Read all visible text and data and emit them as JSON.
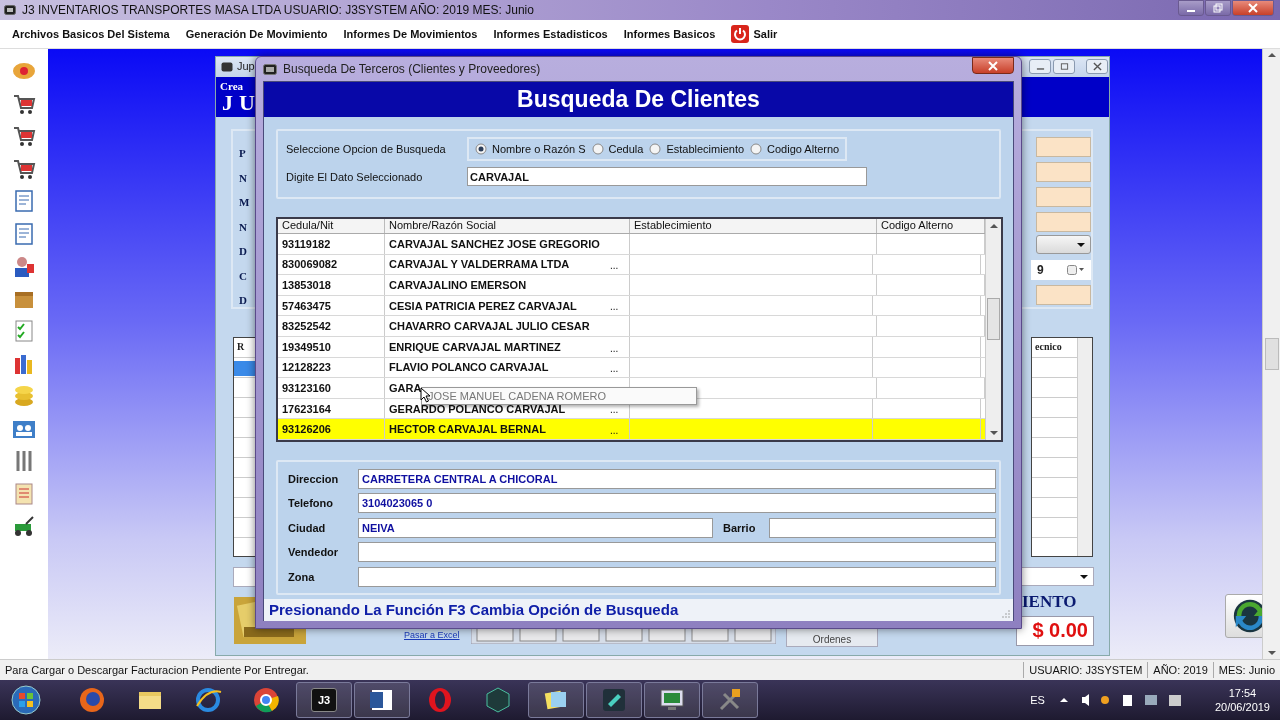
{
  "app": {
    "title": "J3 INVENTARIOS TRANSPORTES MASA LTDA USUARIO: J3SYSTEM AÑO: 2019 MES: Junio"
  },
  "menu": [
    {
      "label": "Archivos Basicos Del Sistema",
      "kind": "item"
    },
    {
      "label": "Generación De Movimiento",
      "kind": "item"
    },
    {
      "label": "Informes De Movimientos",
      "kind": "item"
    },
    {
      "label": "Informes Estadisticos",
      "kind": "item"
    },
    {
      "label": "Informes Basicos",
      "kind": "item"
    },
    {
      "label": "Salir",
      "kind": "exit"
    }
  ],
  "background_window": {
    "title": "Jup",
    "header_small": "Crea",
    "header_big": "JU",
    "labels": [
      "P",
      "N",
      "M",
      "N",
      "D",
      "C",
      "D"
    ],
    "date_fragment": "9",
    "left_column": "R",
    "right_column": "ecnico",
    "total_heading": "IENTO",
    "total": "$ 0.00",
    "export_link": "Pasar a Excel",
    "orders_button": "Ordenes"
  },
  "dialog": {
    "title": "Busqueda De Terceros (Clientes y Proveedores)",
    "heading": "Busqueda De Clientes",
    "option_label": "Seleccione Opcion de Busqueda",
    "options": [
      {
        "label": "Nombre o Razón S",
        "selected": true
      },
      {
        "label": "Cedula",
        "selected": false
      },
      {
        "label": "Establecimiento",
        "selected": false
      },
      {
        "label": "Codigo Alterno",
        "selected": false
      }
    ],
    "input_label": "Digite El  Dato Seleccionado",
    "input_value": "CARVAJAL",
    "table": {
      "columns": [
        "Cedula/Nit",
        "Nombre/Razón Social",
        "Establecimiento",
        "Codigo Alterno"
      ],
      "rows": [
        {
          "cedula": "93119182",
          "name": "CARVAJAL SANCHEZ JOSE GREGORIO",
          "selected": false
        },
        {
          "cedula": "830069082",
          "name": "CARVAJAL Y VALDERRAMA LTDA",
          "more": "...",
          "selected": false
        },
        {
          "cedula": "13853018",
          "name": "CARVAJALINO  EMERSON",
          "selected": false
        },
        {
          "cedula": "57463475",
          "name": "CESIA PATRICIA PEREZ CARVAJAL",
          "more": "...",
          "selected": false
        },
        {
          "cedula": "83252542",
          "name": "CHAVARRO CARVAJAL JULIO CESAR",
          "selected": false
        },
        {
          "cedula": "19349510",
          "name": "ENRIQUE CARVAJAL MARTINEZ",
          "more": "...",
          "selected": false
        },
        {
          "cedula": "12128223",
          "name": "FLAVIO POLANCO CARVAJAL",
          "more": "...",
          "selected": false
        },
        {
          "cedula": "93123160",
          "name": "GARA",
          "selected": false
        },
        {
          "cedula": "17623164",
          "name": "GERARDO POLANCO CARVAJAL",
          "more": "...",
          "selected": false
        },
        {
          "cedula": "93126206",
          "name": "HECTOR CARVAJAL BERNAL",
          "more": "...",
          "selected": true
        }
      ],
      "tooltip": "JOSE MANUEL CADENA ROMERO"
    },
    "details": [
      {
        "label": "Direccion",
        "value": "CARRETERA CENTRAL A CHICORAL"
      },
      {
        "label": "Telefono",
        "value": "3104023065 0"
      },
      {
        "label": "Ciudad",
        "value": "NEIVA",
        "extra_label": "Barrio"
      },
      {
        "label": "Vendedor"
      },
      {
        "label": "Zona"
      }
    ],
    "hint": "Presionando La Función F3 Cambia Opción de Busqueda"
  },
  "status_bar": {
    "message": "Para Cargar o Descargar Facturacion Pendiente Por Entregar.",
    "panels": [
      "USUARIO: J3SYSTEM",
      "AÑO: 2019",
      "MES: Junio"
    ]
  },
  "taskbar": {
    "app_label": "J3",
    "language": "ES",
    "time": "17:54",
    "date": "20/06/2019"
  }
}
